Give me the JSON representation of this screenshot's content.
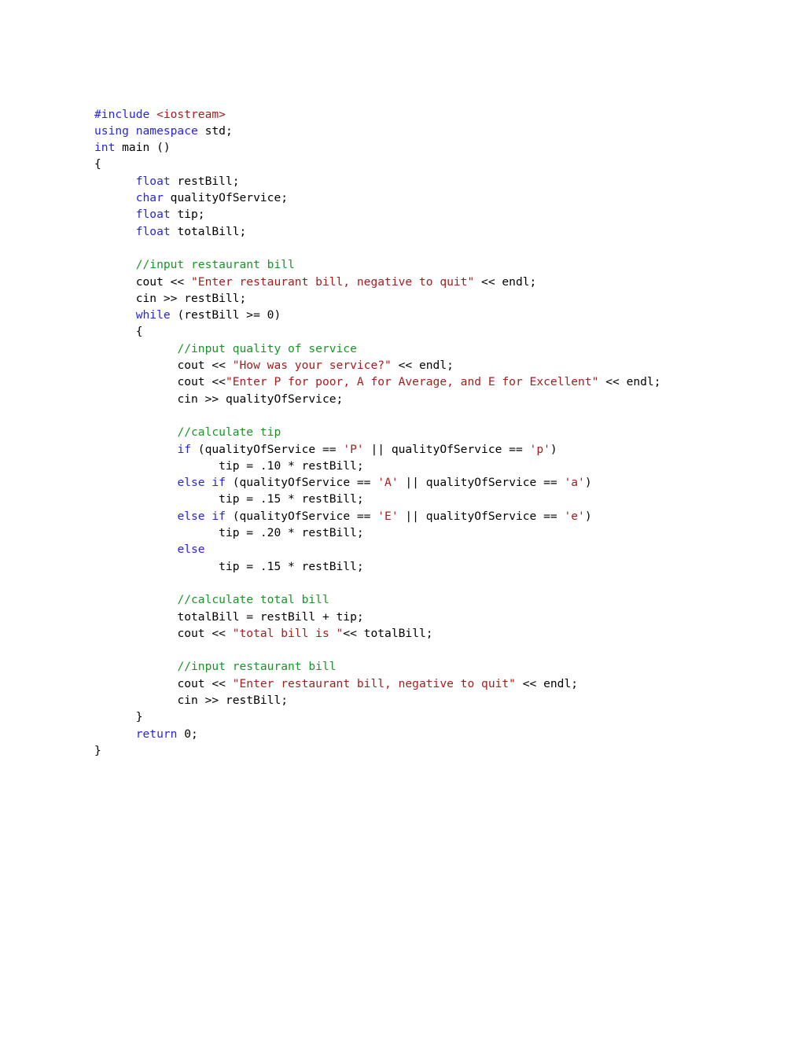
{
  "document": {
    "kind": "source-code-listing",
    "language": "C++",
    "background_color": "#ffffff"
  },
  "syntax_colors": {
    "keyword": "#2626e0",
    "string": "#a02020",
    "comment": "#1a9427",
    "plain": "#000000"
  },
  "code": {
    "indent_unit_chars": 6,
    "lines": [
      {
        "indent": 0,
        "tokens": [
          {
            "t": "#include ",
            "c": "kw"
          },
          {
            "t": "<iostream>",
            "c": "str"
          }
        ]
      },
      {
        "indent": 0,
        "tokens": [
          {
            "t": "using namespace ",
            "c": "kw"
          },
          {
            "t": "std;",
            "c": "plain"
          }
        ]
      },
      {
        "indent": 0,
        "tokens": [
          {
            "t": "int",
            "c": "kw"
          },
          {
            "t": " main ()",
            "c": "plain"
          }
        ]
      },
      {
        "indent": 0,
        "tokens": [
          {
            "t": "{",
            "c": "plain"
          }
        ]
      },
      {
        "indent": 1,
        "tokens": [
          {
            "t": "float",
            "c": "kw"
          },
          {
            "t": " restBill;",
            "c": "plain"
          }
        ]
      },
      {
        "indent": 1,
        "tokens": [
          {
            "t": "char",
            "c": "kw"
          },
          {
            "t": " qualityOfService;",
            "c": "plain"
          }
        ]
      },
      {
        "indent": 1,
        "tokens": [
          {
            "t": "float",
            "c": "kw"
          },
          {
            "t": " tip;",
            "c": "plain"
          }
        ]
      },
      {
        "indent": 1,
        "tokens": [
          {
            "t": "float",
            "c": "kw"
          },
          {
            "t": " totalBill;",
            "c": "plain"
          }
        ]
      },
      {
        "indent": 0,
        "tokens": []
      },
      {
        "indent": 1,
        "tokens": [
          {
            "t": "//input restaurant bill",
            "c": "cmt"
          }
        ]
      },
      {
        "indent": 1,
        "tokens": [
          {
            "t": "cout << ",
            "c": "plain"
          },
          {
            "t": "\"Enter restaurant bill, negative to quit\"",
            "c": "str"
          },
          {
            "t": " << endl;",
            "c": "plain"
          }
        ]
      },
      {
        "indent": 1,
        "tokens": [
          {
            "t": "cin >> restBill;",
            "c": "plain"
          }
        ]
      },
      {
        "indent": 1,
        "tokens": [
          {
            "t": "while",
            "c": "kw"
          },
          {
            "t": " (restBill >= 0)",
            "c": "plain"
          }
        ]
      },
      {
        "indent": 1,
        "tokens": [
          {
            "t": "{",
            "c": "plain"
          }
        ]
      },
      {
        "indent": 2,
        "tokens": [
          {
            "t": "//input quality of service",
            "c": "cmt"
          }
        ]
      },
      {
        "indent": 2,
        "tokens": [
          {
            "t": "cout << ",
            "c": "plain"
          },
          {
            "t": "\"How was your service?\"",
            "c": "str"
          },
          {
            "t": " << endl;",
            "c": "plain"
          }
        ]
      },
      {
        "indent": 2,
        "tokens": [
          {
            "t": "cout <<",
            "c": "plain"
          },
          {
            "t": "\"Enter P for poor, A for Average, and E for Excellent\"",
            "c": "str"
          },
          {
            "t": " << endl;",
            "c": "plain"
          }
        ]
      },
      {
        "indent": 2,
        "tokens": [
          {
            "t": "cin >> qualityOfService;",
            "c": "plain"
          }
        ]
      },
      {
        "indent": 0,
        "tokens": []
      },
      {
        "indent": 2,
        "tokens": [
          {
            "t": "//calculate tip",
            "c": "cmt"
          }
        ]
      },
      {
        "indent": 2,
        "tokens": [
          {
            "t": "if",
            "c": "kw"
          },
          {
            "t": " (qualityOfService == ",
            "c": "plain"
          },
          {
            "t": "'P'",
            "c": "str"
          },
          {
            "t": " || qualityOfService == ",
            "c": "plain"
          },
          {
            "t": "'p'",
            "c": "str"
          },
          {
            "t": ")",
            "c": "plain"
          }
        ]
      },
      {
        "indent": 3,
        "tokens": [
          {
            "t": "tip = .10 * restBill;",
            "c": "plain"
          }
        ]
      },
      {
        "indent": 2,
        "tokens": [
          {
            "t": "else if",
            "c": "kw"
          },
          {
            "t": " (qualityOfService == ",
            "c": "plain"
          },
          {
            "t": "'A'",
            "c": "str"
          },
          {
            "t": " || qualityOfService == ",
            "c": "plain"
          },
          {
            "t": "'a'",
            "c": "str"
          },
          {
            "t": ")",
            "c": "plain"
          }
        ]
      },
      {
        "indent": 3,
        "tokens": [
          {
            "t": "tip = .15 * restBill;",
            "c": "plain"
          }
        ]
      },
      {
        "indent": 2,
        "tokens": [
          {
            "t": "else if",
            "c": "kw"
          },
          {
            "t": " (qualityOfService == ",
            "c": "plain"
          },
          {
            "t": "'E'",
            "c": "str"
          },
          {
            "t": " || qualityOfService == ",
            "c": "plain"
          },
          {
            "t": "'e'",
            "c": "str"
          },
          {
            "t": ")",
            "c": "plain"
          }
        ]
      },
      {
        "indent": 3,
        "tokens": [
          {
            "t": "tip = .20 * restBill;",
            "c": "plain"
          }
        ]
      },
      {
        "indent": 2,
        "tokens": [
          {
            "t": "else",
            "c": "kw"
          }
        ]
      },
      {
        "indent": 3,
        "tokens": [
          {
            "t": "tip = .15 * restBill;",
            "c": "plain"
          }
        ]
      },
      {
        "indent": 0,
        "tokens": []
      },
      {
        "indent": 2,
        "tokens": [
          {
            "t": "//calculate total bill",
            "c": "cmt"
          }
        ]
      },
      {
        "indent": 2,
        "tokens": [
          {
            "t": "totalBill = restBill + tip;",
            "c": "plain"
          }
        ]
      },
      {
        "indent": 2,
        "tokens": [
          {
            "t": "cout << ",
            "c": "plain"
          },
          {
            "t": "\"total bill is \"",
            "c": "str"
          },
          {
            "t": "<< totalBill;",
            "c": "plain"
          }
        ]
      },
      {
        "indent": 0,
        "tokens": []
      },
      {
        "indent": 2,
        "tokens": [
          {
            "t": "//input restaurant bill",
            "c": "cmt"
          }
        ]
      },
      {
        "indent": 2,
        "tokens": [
          {
            "t": "cout << ",
            "c": "plain"
          },
          {
            "t": "\"Enter restaurant bill, negative to quit\"",
            "c": "str"
          },
          {
            "t": " << endl;",
            "c": "plain"
          }
        ]
      },
      {
        "indent": 2,
        "tokens": [
          {
            "t": "cin >> restBill;",
            "c": "plain"
          }
        ]
      },
      {
        "indent": 1,
        "tokens": [
          {
            "t": "}",
            "c": "plain"
          }
        ]
      },
      {
        "indent": 1,
        "tokens": [
          {
            "t": "return",
            "c": "kw"
          },
          {
            "t": " 0;",
            "c": "plain"
          }
        ]
      },
      {
        "indent": 0,
        "tokens": [
          {
            "t": "}",
            "c": "plain"
          }
        ]
      }
    ]
  }
}
